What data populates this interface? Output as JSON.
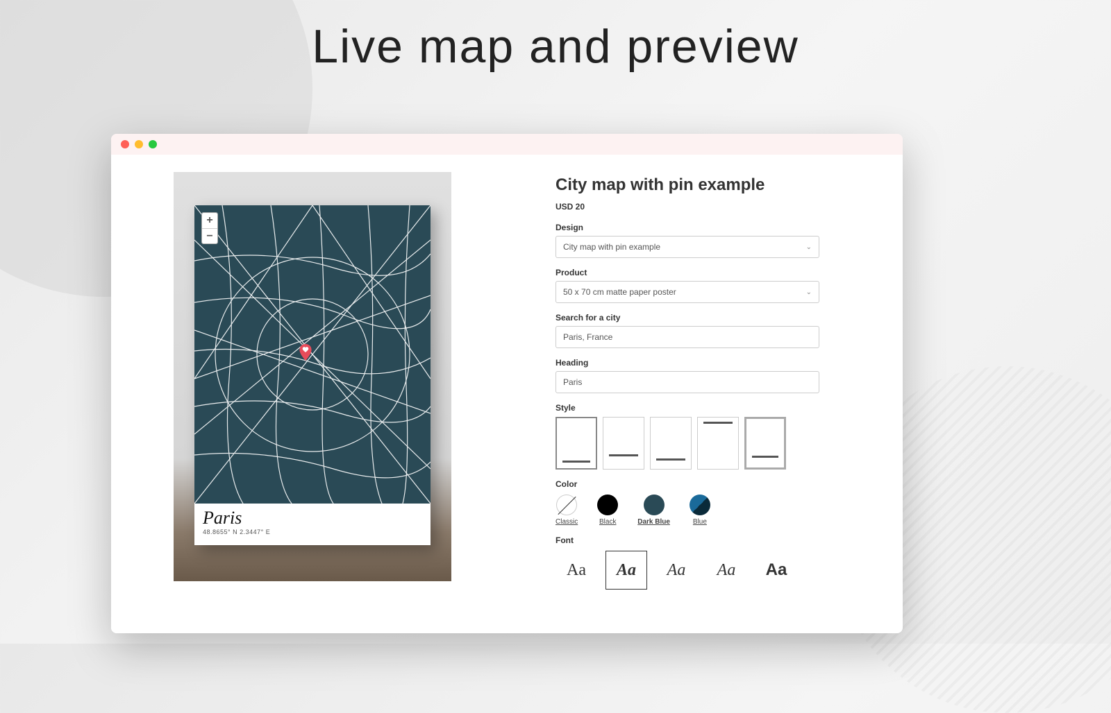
{
  "page": {
    "title": "Live map and preview"
  },
  "product": {
    "title": "City map with pin example",
    "price_label": "USD 20"
  },
  "fields": {
    "design": {
      "label": "Design",
      "value": "City map with pin example"
    },
    "product": {
      "label": "Product",
      "value": "50 x 70 cm matte paper poster"
    },
    "search": {
      "label": "Search for a city",
      "value": "Paris, France"
    },
    "heading": {
      "label": "Heading",
      "value": "Paris"
    },
    "style": {
      "label": "Style"
    },
    "color": {
      "label": "Color"
    },
    "font": {
      "label": "Font"
    }
  },
  "colors": [
    {
      "key": "classic",
      "label": "Classic"
    },
    {
      "key": "black",
      "label": "Black"
    },
    {
      "key": "darkblue",
      "label": "Dark Blue",
      "selected": true
    },
    {
      "key": "blue",
      "label": "Blue"
    }
  ],
  "fonts": [
    "Aa",
    "Aa",
    "Aa",
    "Aa",
    "Aa"
  ],
  "preview": {
    "city": "Paris",
    "coords": "48.8655° N 2.3447° E"
  },
  "zoom": {
    "in": "+",
    "out": "−"
  }
}
